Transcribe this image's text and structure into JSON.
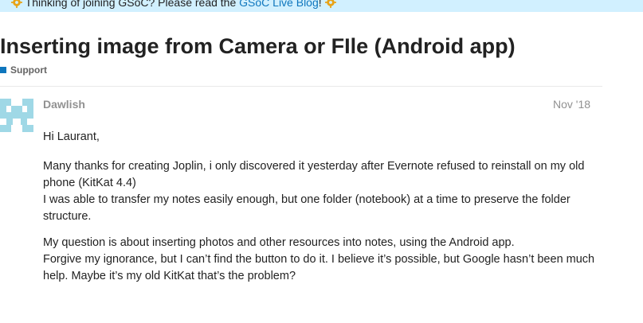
{
  "banner": {
    "text_before": "Thinking of joining GSoC? Please read the ",
    "link_text": "GSoC Live Blog",
    "text_after": "!",
    "gear_color": "#e8a317"
  },
  "topic": {
    "title": "Inserting image from Camera or FIle (Android app)",
    "category": "Support",
    "category_color": "#0e76bd"
  },
  "post": {
    "username": "Dawlish",
    "date": "Nov '18",
    "avatar_color": "#9fd8e6",
    "greeting": "Hi Laurant,",
    "paragraph1_line1": "Many thanks for creating Joplin, i only discovered it yesterday after Evernote refused to reinstall on my old phone (KitKat 4.4)",
    "paragraph1_line2": "I was able to transfer my notes easily enough, but one folder (notebook) at a time to preserve the folder structure.",
    "paragraph2_line1": "My question is about inserting photos and other resources into notes, using the Android app.",
    "paragraph2_line2": "Forgive my ignorance, but I can’t find the button to do it. I believe it’s possible, but Google hasn’t been much help. Maybe it’s my old KitKat that’s the problem?"
  }
}
